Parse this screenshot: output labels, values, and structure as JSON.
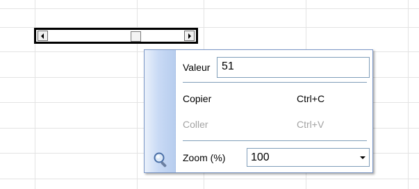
{
  "popup": {
    "value_label": "Valeur",
    "value": "51",
    "menu": [
      {
        "label": "Copier",
        "shortcut": "Ctrl+C",
        "enabled": true
      },
      {
        "label": "Coller",
        "shortcut": "Ctrl+V",
        "enabled": false
      }
    ],
    "zoom_label": "Zoom (%)",
    "zoom_value": "100",
    "icon": "magnifier-icon"
  },
  "scrollbar": {
    "value": 51,
    "icons": [
      "arrow-left-icon",
      "arrow-right-icon"
    ]
  }
}
